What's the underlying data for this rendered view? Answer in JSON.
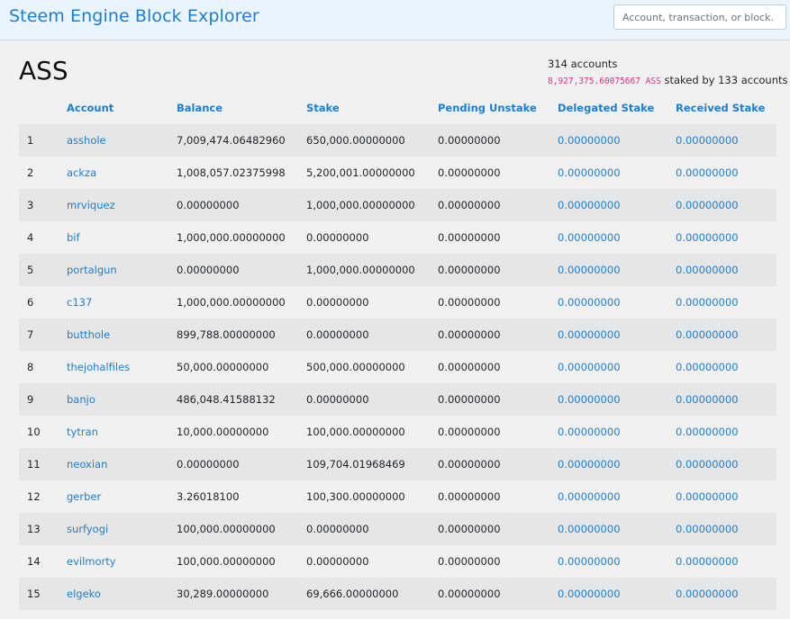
{
  "navbar": {
    "brand": "Steem Engine Block Explorer",
    "search_placeholder": "Account, transaction, or block."
  },
  "token": {
    "symbol": "ASS",
    "accounts_count": "314 accounts",
    "staked_amount": "8,927,375.60075667 ASS",
    "staked_suffix": "staked by 133 accounts"
  },
  "table": {
    "headers": [
      "",
      "Account",
      "Balance",
      "Stake",
      "Pending Unstake",
      "Delegated Stake",
      "Received Stake"
    ],
    "rows": [
      {
        "rank": "1",
        "account": "asshole",
        "balance": "7,009,474.06482960",
        "stake": "650,000.00000000",
        "pending": "0.00000000",
        "delegated": "0.00000000",
        "received": "0.00000000"
      },
      {
        "rank": "2",
        "account": "ackza",
        "balance": "1,008,057.02375998",
        "stake": "5,200,001.00000000",
        "pending": "0.00000000",
        "delegated": "0.00000000",
        "received": "0.00000000"
      },
      {
        "rank": "3",
        "account": "mrviquez",
        "balance": "0.00000000",
        "stake": "1,000,000.00000000",
        "pending": "0.00000000",
        "delegated": "0.00000000",
        "received": "0.00000000"
      },
      {
        "rank": "4",
        "account": "bif",
        "balance": "1,000,000.00000000",
        "stake": "0.00000000",
        "pending": "0.00000000",
        "delegated": "0.00000000",
        "received": "0.00000000"
      },
      {
        "rank": "5",
        "account": "portalgun",
        "balance": "0.00000000",
        "stake": "1,000,000.00000000",
        "pending": "0.00000000",
        "delegated": "0.00000000",
        "received": "0.00000000"
      },
      {
        "rank": "6",
        "account": "c137",
        "balance": "1,000,000.00000000",
        "stake": "0.00000000",
        "pending": "0.00000000",
        "delegated": "0.00000000",
        "received": "0.00000000"
      },
      {
        "rank": "7",
        "account": "butthole",
        "balance": "899,788.00000000",
        "stake": "0.00000000",
        "pending": "0.00000000",
        "delegated": "0.00000000",
        "received": "0.00000000"
      },
      {
        "rank": "8",
        "account": "thejohalfiles",
        "balance": "50,000.00000000",
        "stake": "500,000.00000000",
        "pending": "0.00000000",
        "delegated": "0.00000000",
        "received": "0.00000000"
      },
      {
        "rank": "9",
        "account": "banjo",
        "balance": "486,048.41588132",
        "stake": "0.00000000",
        "pending": "0.00000000",
        "delegated": "0.00000000",
        "received": "0.00000000"
      },
      {
        "rank": "10",
        "account": "tytran",
        "balance": "10,000.00000000",
        "stake": "100,000.00000000",
        "pending": "0.00000000",
        "delegated": "0.00000000",
        "received": "0.00000000"
      },
      {
        "rank": "11",
        "account": "neoxian",
        "balance": "0.00000000",
        "stake": "109,704.01968469",
        "pending": "0.00000000",
        "delegated": "0.00000000",
        "received": "0.00000000"
      },
      {
        "rank": "12",
        "account": "gerber",
        "balance": "3.26018100",
        "stake": "100,300.00000000",
        "pending": "0.00000000",
        "delegated": "0.00000000",
        "received": "0.00000000"
      },
      {
        "rank": "13",
        "account": "surfyogi",
        "balance": "100,000.00000000",
        "stake": "0.00000000",
        "pending": "0.00000000",
        "delegated": "0.00000000",
        "received": "0.00000000"
      },
      {
        "rank": "14",
        "account": "evilmorty",
        "balance": "100,000.00000000",
        "stake": "0.00000000",
        "pending": "0.00000000",
        "delegated": "0.00000000",
        "received": "0.00000000"
      },
      {
        "rank": "15",
        "account": "elgeko",
        "balance": "30,289.00000000",
        "stake": "69,666.00000000",
        "pending": "0.00000000",
        "delegated": "0.00000000",
        "received": "0.00000000"
      }
    ]
  },
  "colors": {
    "link": "#1a7fd4",
    "navbar_bg": "#eaf4fd",
    "row_stripe": "#e6e6e6",
    "staked_amount": "#d63384"
  }
}
